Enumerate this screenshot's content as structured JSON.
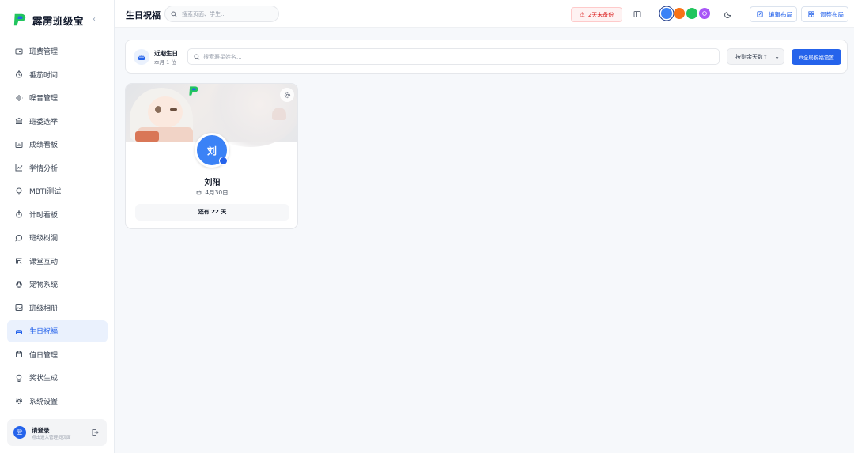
{
  "app": {
    "name": "霹雳班级宝",
    "collapse_icon": "chevron-left-icon"
  },
  "sidebar": {
    "items": [
      {
        "label": "班费管理",
        "icon": "wallet-icon",
        "active": false
      },
      {
        "label": "番茄时间",
        "icon": "timer-icon",
        "active": false
      },
      {
        "label": "噪音管理",
        "icon": "waveform-icon",
        "active": false
      },
      {
        "label": "班委选举",
        "icon": "ballot-icon",
        "active": false
      },
      {
        "label": "成绩看板",
        "icon": "board-icon",
        "active": false
      },
      {
        "label": "学情分析",
        "icon": "trend-icon",
        "active": false
      },
      {
        "label": "MBTI测试",
        "icon": "compass-icon",
        "active": false
      },
      {
        "label": "计时看板",
        "icon": "stopwatch-icon",
        "active": false
      },
      {
        "label": "班级树洞",
        "icon": "chat-icon",
        "active": false
      },
      {
        "label": "课堂互动",
        "icon": "interact-icon",
        "active": false
      },
      {
        "label": "宠物系统",
        "icon": "paw-icon",
        "active": false
      },
      {
        "label": "班级相册",
        "icon": "image-icon",
        "active": false
      },
      {
        "label": "生日祝福",
        "icon": "cake-icon",
        "active": true
      },
      {
        "label": "值日管理",
        "icon": "calendar-icon",
        "active": false
      },
      {
        "label": "奖状生成",
        "icon": "award-icon",
        "active": false
      },
      {
        "label": "系统设置",
        "icon": "gear-icon",
        "active": false
      }
    ],
    "login": {
      "avatar_text": "登",
      "title": "请登录",
      "subtitle": "点击进入管理员页面"
    }
  },
  "topbar": {
    "page_title": "生日祝福",
    "search_placeholder": "搜索页面、学生...",
    "backup_warning": "2天未备份",
    "theme_colors": [
      "#3b82f6",
      "#f97316",
      "#22c55e",
      "#a855f7"
    ],
    "edit_layout": "编辑布局",
    "adjust_layout": "调整布局"
  },
  "filter": {
    "title": "近期生日",
    "subtitle": "本月 1 位",
    "search_placeholder": "搜索寿星姓名...",
    "sort_label": "按剩余天数↑",
    "global_button": "⚙全局祝福设置"
  },
  "cards": [
    {
      "avatar_text": "刘",
      "name": "刘阳",
      "date": "4月30日",
      "countdown": "还有 22 天"
    }
  ]
}
